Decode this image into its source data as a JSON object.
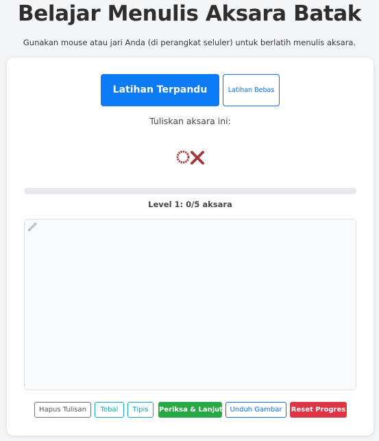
{
  "header": {
    "title": "Belajar Menulis Aksara Batak",
    "subtitle": "Gunakan mouse atau jari Anda (di perangkat seluler) untuk berlatih menulis aksara."
  },
  "modes": {
    "guided_label": "Latihan Terpandu",
    "free_label": "Latihan Bebas",
    "active": "guided"
  },
  "exercise": {
    "prompt": "Tuliskan aksara ini:",
    "glyph_icon": "batak-script-character",
    "glyph_color": "#a33a3a",
    "progress_fraction": 0,
    "level_text": "Level 1: 0/5 aksara"
  },
  "canvas": {
    "icon": "pencil-icon"
  },
  "actions": {
    "clear": "Hapus Tulisan",
    "thick": "Tebal",
    "thin": "Tipis",
    "check": "Periksa & Lanjut",
    "download": "Unduh Gambar",
    "reset": "Reset Progres"
  },
  "colors": {
    "primary": "#0d7bf6",
    "success": "#28a745",
    "danger": "#dc3545",
    "info": "#17a2b8"
  }
}
